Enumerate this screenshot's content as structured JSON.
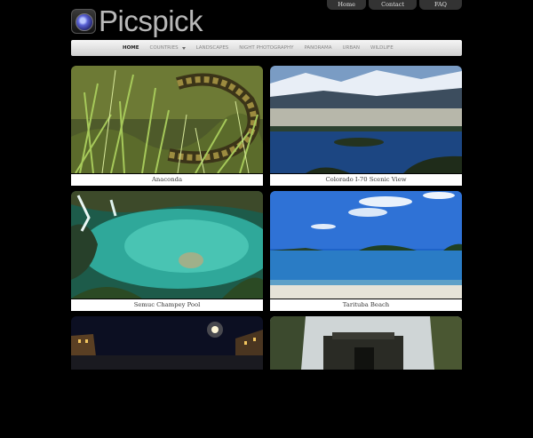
{
  "site": {
    "name": "Picspick"
  },
  "top_links": [
    {
      "label": "Home"
    },
    {
      "label": "Contact"
    },
    {
      "label": "FAQ"
    }
  ],
  "nav": {
    "items": [
      {
        "label": "HOME",
        "active": true
      },
      {
        "label": "COUNTRIES",
        "has_dropdown": true
      },
      {
        "label": "LANDSCAPES"
      },
      {
        "label": "NIGHT PHOTOGRAPHY"
      },
      {
        "label": "PANORAMA"
      },
      {
        "label": "URBAN"
      },
      {
        "label": "WILDLIFE"
      }
    ]
  },
  "gallery": [
    {
      "caption": "Anaconda"
    },
    {
      "caption": "Colorado I-70 Scenic View"
    },
    {
      "caption": "Semuc Champey Pool"
    },
    {
      "caption": "Tarituba Beach"
    }
  ]
}
